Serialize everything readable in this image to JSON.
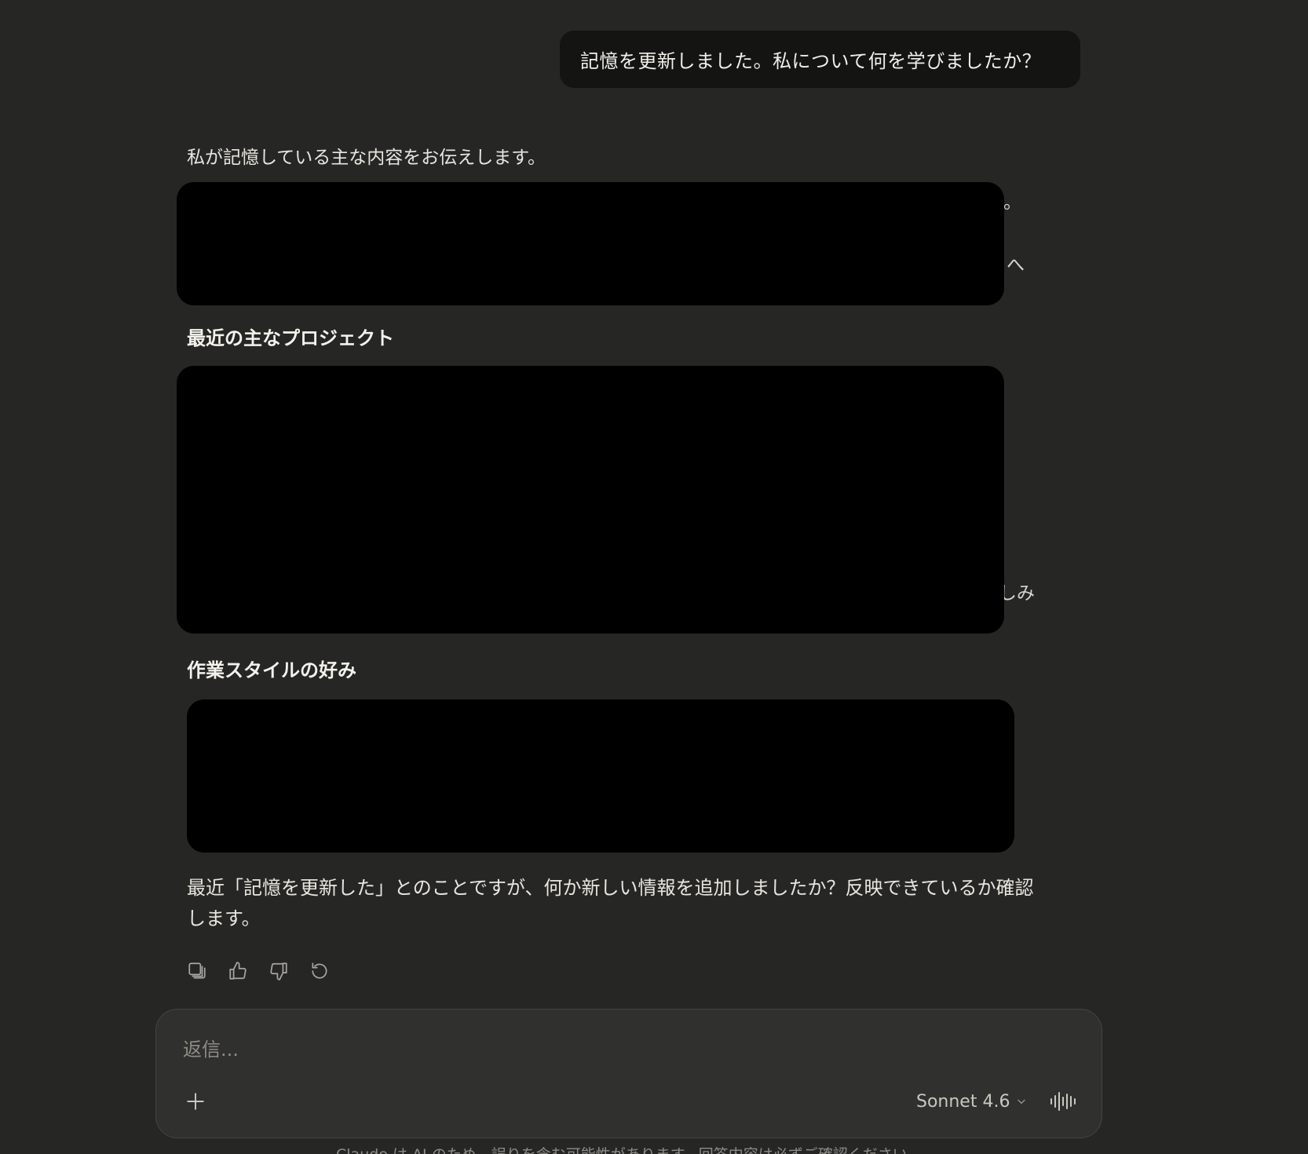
{
  "user_message": "記憶を更新しました。私について何を学びましたか？",
  "assistant": {
    "intro": "私が記憶している主な内容をお伝えします。",
    "peek_1": "。",
    "peek_2": "へ",
    "heading_projects": "最近の主なプロジェクト",
    "peek_3": "しみ",
    "heading_style": "作業スタイルの好み",
    "closing": "最近「記憶を更新した」とのことですが、何か新しい情報を追加しましたか？反映できているか確認します。"
  },
  "actions": {
    "copy_icon": "copy-icon",
    "thumbs_up_icon": "thumbs-up-icon",
    "thumbs_down_icon": "thumbs-down-icon",
    "retry_icon": "retry-icon"
  },
  "composer": {
    "placeholder": "返信...",
    "value": "",
    "model_label": "Sonnet 4.6"
  },
  "footer_note": "Claude は AI のため、誤りを含む可能性があります。回答内容は必ずご確認ください。",
  "colors": {
    "background": "#262624",
    "user_bubble": "#141413",
    "composer": "#30302e",
    "redaction": "#000000"
  }
}
